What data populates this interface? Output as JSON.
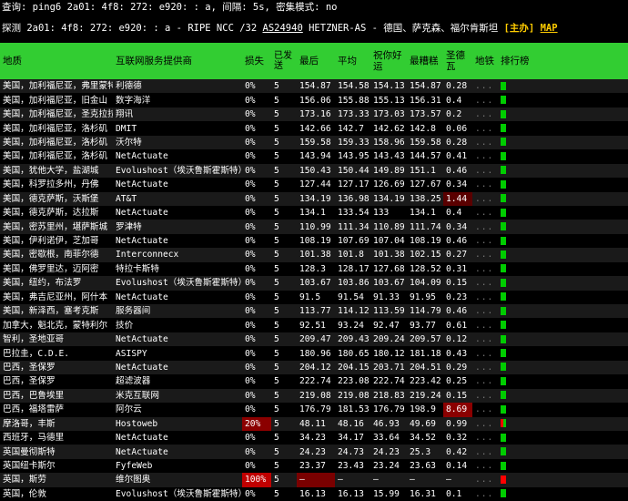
{
  "query_line": "查询: ping6 2a01: 4f8: 272: e920: : a, 间隔: 5s, 密集模式: no",
  "probe": {
    "prefix": "探测 2a01: 4f8: 272: e920: : a - RIPE NCC /32 ",
    "asn": "AS24940",
    "middle": " HETZNER-AS - 德国、萨克森、福尔肯斯坦 ",
    "owner": "[主办]",
    "map": "MAP"
  },
  "columns": {
    "location": "地质",
    "isp": "互联网服务提供商",
    "loss": "损失",
    "sent": "已发送",
    "last": "最后",
    "avg": "平均",
    "best": "祝你好运",
    "worst": "最糟糕",
    "stdev": "圣德瓦",
    "metro": "地铁",
    "rank": "排行榜"
  },
  "colors": {
    "header_bg": "#32cd32",
    "rank_green": "#00cc00",
    "rank_red": "#ff0000",
    "loss_red": "#c00000"
  },
  "rows": [
    {
      "loc": "美国，加利福尼亚，弗里蒙特",
      "isp": "利德德",
      "loss": "0%",
      "sent": "5",
      "last": "154.87",
      "avg": "154.58",
      "best": "154.13",
      "worst": "154.87",
      "sd": "0.28",
      "metro": "...",
      "rank": "green"
    },
    {
      "loc": "美国，加利福尼亚，旧金山",
      "isp": "数字海洋",
      "loss": "0%",
      "sent": "5",
      "last": "156.06",
      "avg": "155.88",
      "best": "155.13",
      "worst": "156.31",
      "sd": "0.4",
      "metro": "...",
      "rank": "green"
    },
    {
      "loc": "美国，加利福尼亚，圣克拉拉",
      "isp": "翔讯",
      "loss": "0%",
      "sent": "5",
      "last": "173.16",
      "avg": "173.33",
      "best": "173.03",
      "worst": "173.57",
      "sd": "0.2",
      "metro": "...",
      "rank": "green"
    },
    {
      "loc": "美国，加利福尼亚，洛杉矶",
      "isp": "DMIT",
      "loss": "0%",
      "sent": "5",
      "last": "142.66",
      "avg": "142.7",
      "best": "142.62",
      "worst": "142.8",
      "sd": "0.06",
      "metro": "...",
      "rank": "green"
    },
    {
      "loc": "美国，加利福尼亚，洛杉矶",
      "isp": "沃尔特",
      "loss": "0%",
      "sent": "5",
      "last": "159.58",
      "avg": "159.33",
      "best": "158.96",
      "worst": "159.58",
      "sd": "0.28",
      "metro": "...",
      "rank": "green"
    },
    {
      "loc": "美国，加利福尼亚，洛杉矶",
      "isp": "NetActuate",
      "loss": "0%",
      "sent": "5",
      "last": "143.94",
      "avg": "143.95",
      "best": "143.43",
      "worst": "144.57",
      "sd": "0.41",
      "metro": "...",
      "rank": "green"
    },
    {
      "loc": "美国，犹他大学，盐湖城",
      "isp": "Evolushost（埃沃鲁斯霍斯特）",
      "loss": "0%",
      "sent": "5",
      "last": "150.43",
      "avg": "150.44",
      "best": "149.89",
      "worst": "151.1",
      "sd": "0.46",
      "metro": "...",
      "rank": "green"
    },
    {
      "loc": "美国，科罗拉多州，丹佛",
      "isp": "NetActuate",
      "loss": "0%",
      "sent": "5",
      "last": "127.44",
      "avg": "127.17",
      "best": "126.69",
      "worst": "127.67",
      "sd": "0.34",
      "metro": "...",
      "rank": "green"
    },
    {
      "loc": "美国，德克萨斯，沃斯堡",
      "isp": "AT&T",
      "loss": "0%",
      "sent": "5",
      "last": "134.19",
      "avg": "136.98",
      "best": "134.19",
      "worst": "138.25",
      "sd": "1.44",
      "metro": "...",
      "rank": "green"
    },
    {
      "loc": "美国，德克萨斯，达拉斯",
      "isp": "NetActuate",
      "loss": "0%",
      "sent": "5",
      "last": "134.1",
      "avg": "133.54",
      "best": "133",
      "worst": "134.1",
      "sd": "0.4",
      "metro": "...",
      "rank": "green"
    },
    {
      "loc": "美国，密苏里州，堪萨斯城",
      "isp": "罗津特",
      "loss": "0%",
      "sent": "5",
      "last": "110.99",
      "avg": "111.34",
      "best": "110.89",
      "worst": "111.74",
      "sd": "0.34",
      "metro": "...",
      "rank": "green"
    },
    {
      "loc": "美国，伊利诺伊，芝加哥",
      "isp": "NetActuate",
      "loss": "0%",
      "sent": "5",
      "last": "108.19",
      "avg": "107.69",
      "best": "107.04",
      "worst": "108.19",
      "sd": "0.46",
      "metro": "...",
      "rank": "green"
    },
    {
      "loc": "美国，密歇根，南菲尔德",
      "isp": "Interconnecx",
      "loss": "0%",
      "sent": "5",
      "last": "101.38",
      "avg": "101.8",
      "best": "101.38",
      "worst": "102.15",
      "sd": "0.27",
      "metro": "...",
      "rank": "green"
    },
    {
      "loc": "美国，佛罗里达，迈阿密",
      "isp": "特拉卡斯特",
      "loss": "0%",
      "sent": "5",
      "last": "128.3",
      "avg": "128.17",
      "best": "127.68",
      "worst": "128.52",
      "sd": "0.31",
      "metro": "...",
      "rank": "green"
    },
    {
      "loc": "美国，纽约，布法罗",
      "isp": "Evolushost（埃沃鲁斯霍斯特）",
      "loss": "0%",
      "sent": "5",
      "last": "103.67",
      "avg": "103.86",
      "best": "103.67",
      "worst": "104.09",
      "sd": "0.15",
      "metro": "...",
      "rank": "green"
    },
    {
      "loc": "美国，弗吉尼亚州，阿什本",
      "isp": "NetActuate",
      "loss": "0%",
      "sent": "5",
      "last": "91.5",
      "avg": "91.54",
      "best": "91.33",
      "worst": "91.95",
      "sd": "0.23",
      "metro": "...",
      "rank": "green"
    },
    {
      "loc": "美国，新泽西，塞考克斯",
      "isp": "服务器间",
      "loss": "0%",
      "sent": "5",
      "last": "113.77",
      "avg": "114.12",
      "best": "113.59",
      "worst": "114.79",
      "sd": "0.46",
      "metro": "...",
      "rank": "green"
    },
    {
      "loc": "加拿大，魁北克，蒙特利尔",
      "isp": "技价",
      "loss": "0%",
      "sent": "5",
      "last": "92.51",
      "avg": "93.24",
      "best": "92.47",
      "worst": "93.77",
      "sd": "0.61",
      "metro": "...",
      "rank": "green"
    },
    {
      "loc": "智利，圣地亚哥",
      "isp": "NetActuate",
      "loss": "0%",
      "sent": "5",
      "last": "209.47",
      "avg": "209.43",
      "best": "209.24",
      "worst": "209.57",
      "sd": "0.12",
      "metro": "...",
      "rank": "green"
    },
    {
      "loc": "巴拉圭，C.D.E.",
      "isp": "ASISPY",
      "loss": "0%",
      "sent": "5",
      "last": "180.96",
      "avg": "180.65",
      "best": "180.12",
      "worst": "181.18",
      "sd": "0.43",
      "metro": "...",
      "rank": "green"
    },
    {
      "loc": "巴西，圣保罗",
      "isp": "NetActuate",
      "loss": "0%",
      "sent": "5",
      "last": "204.12",
      "avg": "204.15",
      "best": "203.71",
      "worst": "204.51",
      "sd": "0.29",
      "metro": "...",
      "rank": "green"
    },
    {
      "loc": "巴西，圣保罗",
      "isp": "超滤波器",
      "loss": "0%",
      "sent": "5",
      "last": "222.74",
      "avg": "223.08",
      "best": "222.74",
      "worst": "223.42",
      "sd": "0.25",
      "metro": "...",
      "rank": "green"
    },
    {
      "loc": "巴西，巴鲁埃里",
      "isp": "米克互联网",
      "loss": "0%",
      "sent": "5",
      "last": "219.08",
      "avg": "219.08",
      "best": "218.83",
      "worst": "219.24",
      "sd": "0.15",
      "metro": "...",
      "rank": "green"
    },
    {
      "loc": "巴西，福塔雷萨",
      "isp": "阿尔云",
      "loss": "0%",
      "sent": "5",
      "last": "176.79",
      "avg": "181.53",
      "best": "176.79",
      "worst": "198.9",
      "sd": "8.69",
      "metro": "...",
      "rank": "green"
    },
    {
      "loc": "摩洛哥，丰斯",
      "isp": "Hostoweb",
      "loss": "20%",
      "sent": "5",
      "last": "48.11",
      "avg": "48.16",
      "best": "46.93",
      "worst": "49.69",
      "sd": "0.99",
      "metro": "...",
      "rank": "mixed"
    },
    {
      "loc": "西班牙，马德里",
      "isp": "NetActuate",
      "loss": "0%",
      "sent": "5",
      "last": "34.23",
      "avg": "34.17",
      "best": "33.64",
      "worst": "34.52",
      "sd": "0.32",
      "metro": "...",
      "rank": "green"
    },
    {
      "loc": "英国曼彻斯特",
      "isp": "NetActuate",
      "loss": "0%",
      "sent": "5",
      "last": "24.23",
      "avg": "24.73",
      "best": "24.23",
      "worst": "25.3",
      "sd": "0.42",
      "metro": "...",
      "rank": "green"
    },
    {
      "loc": "英国纽卡斯尔",
      "isp": "FyfeWeb",
      "loss": "0%",
      "sent": "5",
      "last": "23.37",
      "avg": "23.43",
      "best": "23.24",
      "worst": "23.63",
      "sd": "0.14",
      "metro": "...",
      "rank": "green"
    },
    {
      "loc": "英国，斯劳",
      "isp": "维尔图奥",
      "loss": "100%",
      "sent": "5",
      "last": "–",
      "avg": "–",
      "best": "–",
      "worst": "–",
      "sd": "–",
      "metro": "...",
      "rank": "red"
    },
    {
      "loc": "英国，伦敦",
      "isp": "Evolushost（埃沃鲁斯霍斯特）",
      "loss": "0%",
      "sent": "5",
      "last": "16.13",
      "avg": "16.13",
      "best": "15.99",
      "worst": "16.31",
      "sd": "0.1",
      "metro": "...",
      "rank": "green"
    }
  ]
}
